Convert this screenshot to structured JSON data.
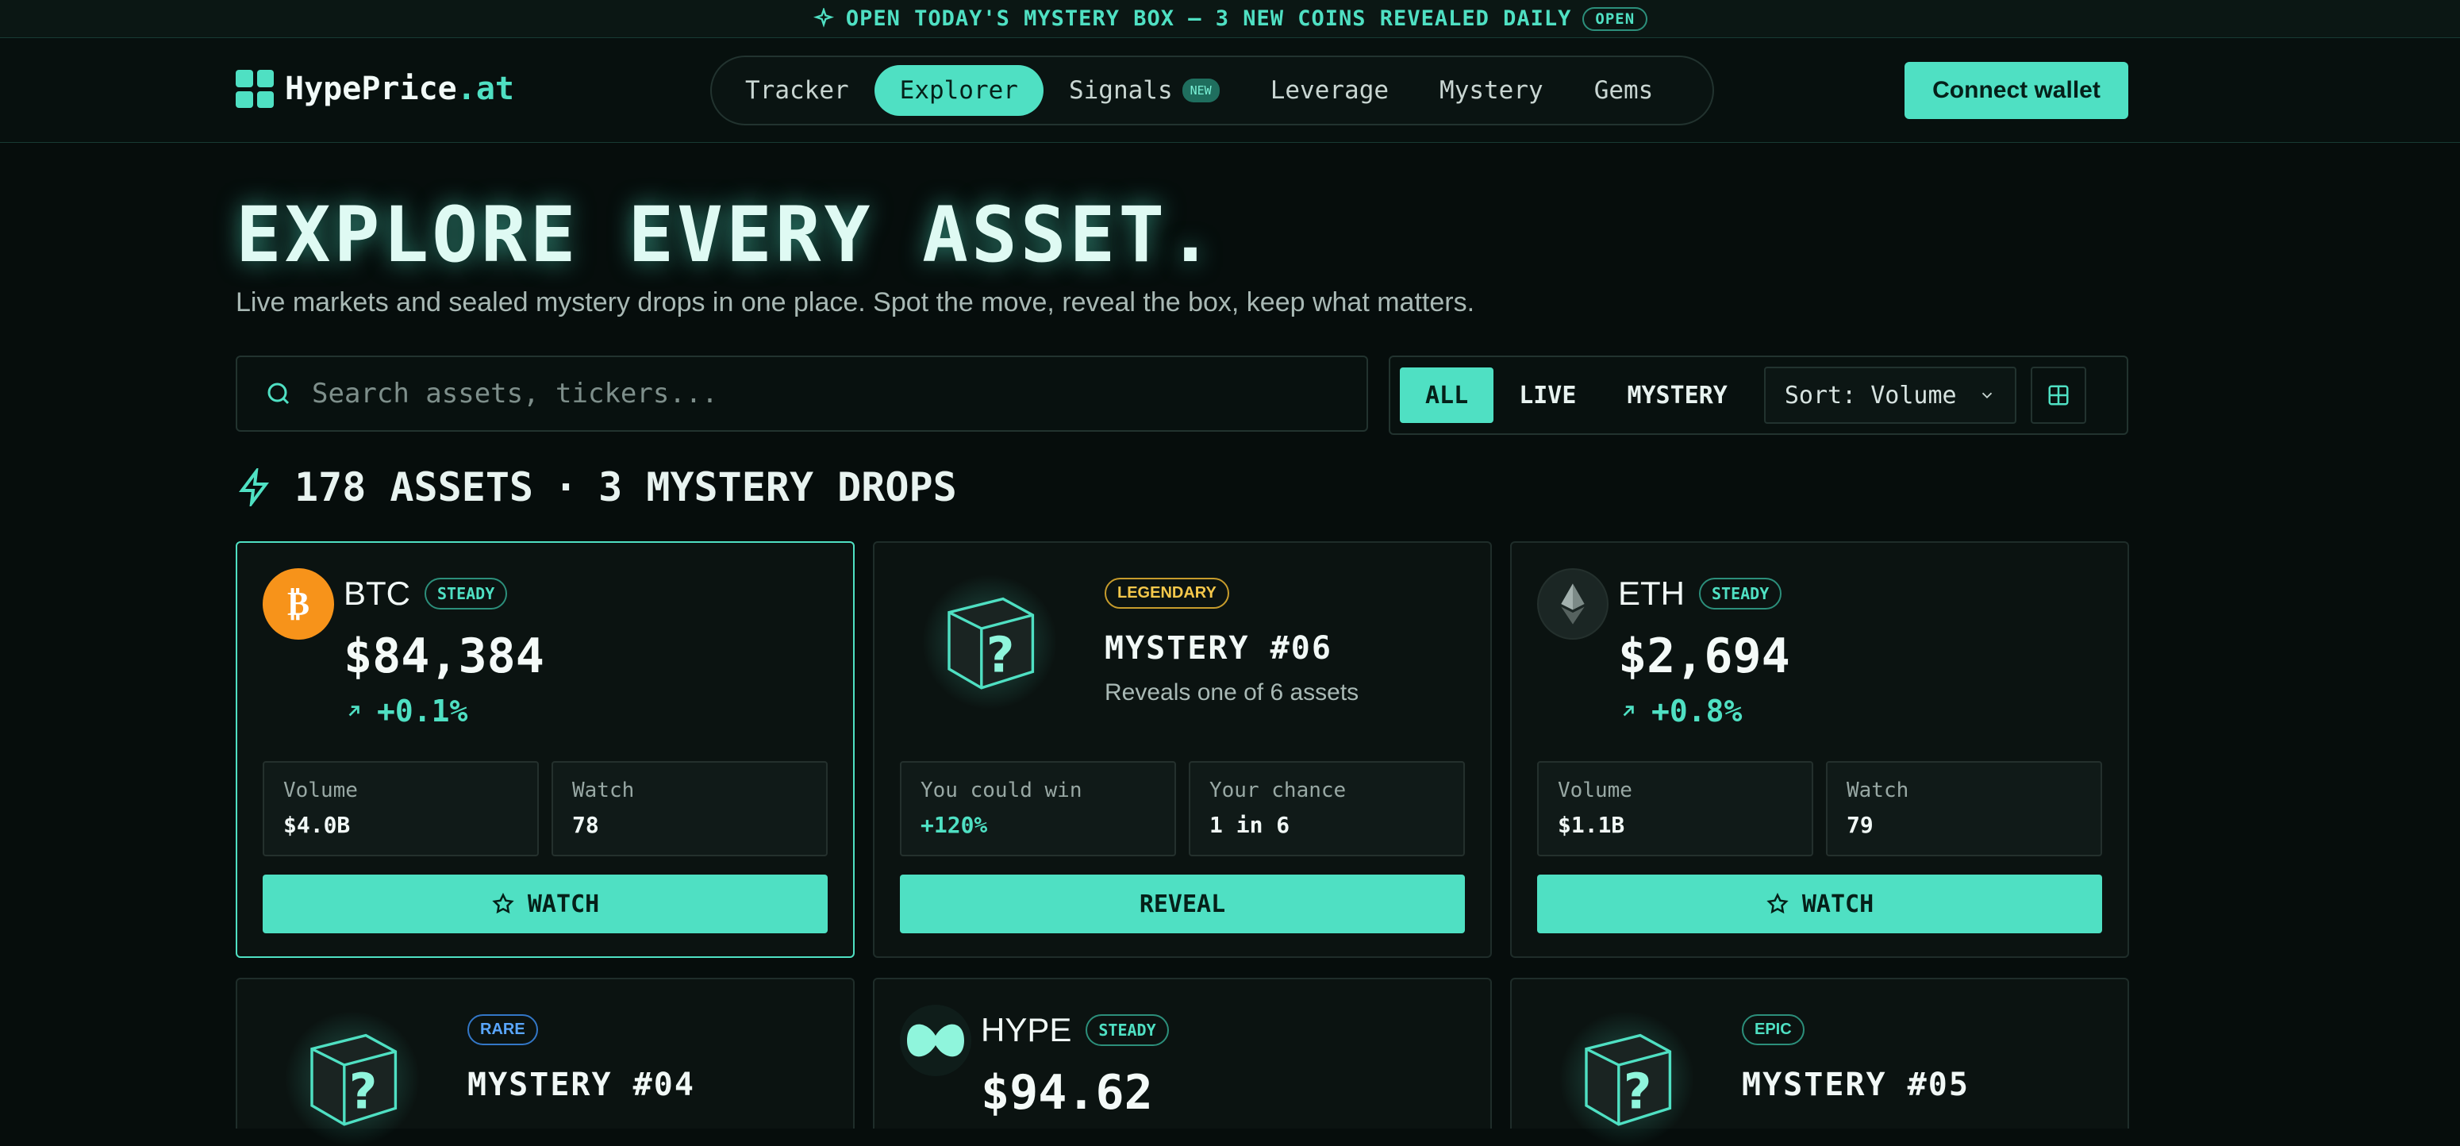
{
  "banner": {
    "text": "OPEN TODAY'S MYSTERY BOX — 3 NEW COINS REVEALED DAILY",
    "pill": "OPEN"
  },
  "nav": {
    "logo_main": "HypePrice",
    "logo_suffix": ".at",
    "items": [
      {
        "label": "Tracker"
      },
      {
        "label": "Explorer",
        "active": true
      },
      {
        "label": "Signals",
        "badge": "NEW"
      },
      {
        "label": "Leverage"
      },
      {
        "label": "Mystery"
      },
      {
        "label": "Gems"
      }
    ],
    "connect_label": "Connect wallet"
  },
  "hero": {
    "title": "EXPLORE EVERY ASSET.",
    "subtitle": "Live markets and sealed mystery drops in one place. Spot the move, reveal the box, keep what matters."
  },
  "search": {
    "placeholder": "Search assets, tickers..."
  },
  "filters": {
    "all": "ALL",
    "live": "LIVE",
    "mystery": "MYSTERY",
    "sort": "Sort: Volume"
  },
  "summary": {
    "assets": "178 ASSETS",
    "sep": "·",
    "drops": "3 MYSTERY DROPS"
  },
  "cards": {
    "btc": {
      "ticker": "BTC",
      "tag": "STEADY",
      "price": "$84,384",
      "change": "+0.1%",
      "stat1_label": "Volume",
      "stat1_value": "$4.0B",
      "stat2_label": "Watch",
      "stat2_value": "78",
      "action": "WATCH"
    },
    "m06": {
      "tag": "LEGENDARY",
      "title": "MYSTERY #06",
      "desc": "Reveals one of 6 assets",
      "stat1_label": "You could win",
      "stat1_value": "+120%",
      "stat2_label": "Your chance",
      "stat2_value": "1 in 6",
      "action": "REVEAL"
    },
    "eth": {
      "ticker": "ETH",
      "tag": "STEADY",
      "price": "$2,694",
      "change": "+0.8%",
      "stat1_label": "Volume",
      "stat1_value": "$1.1B",
      "stat2_label": "Watch",
      "stat2_value": "79",
      "action": "WATCH"
    },
    "m04": {
      "tag": "RARE",
      "title": "MYSTERY #04"
    },
    "hype": {
      "ticker": "HYPE",
      "tag": "STEADY",
      "price": "$94.62"
    },
    "m05": {
      "tag": "EPIC",
      "title": "MYSTERY #05"
    }
  },
  "colors": {
    "accent": "#4fe0c3",
    "background": "#060d0c",
    "legendary": "#f5c84b",
    "rare": "#5aa7ff",
    "btc": "#f7931a"
  }
}
